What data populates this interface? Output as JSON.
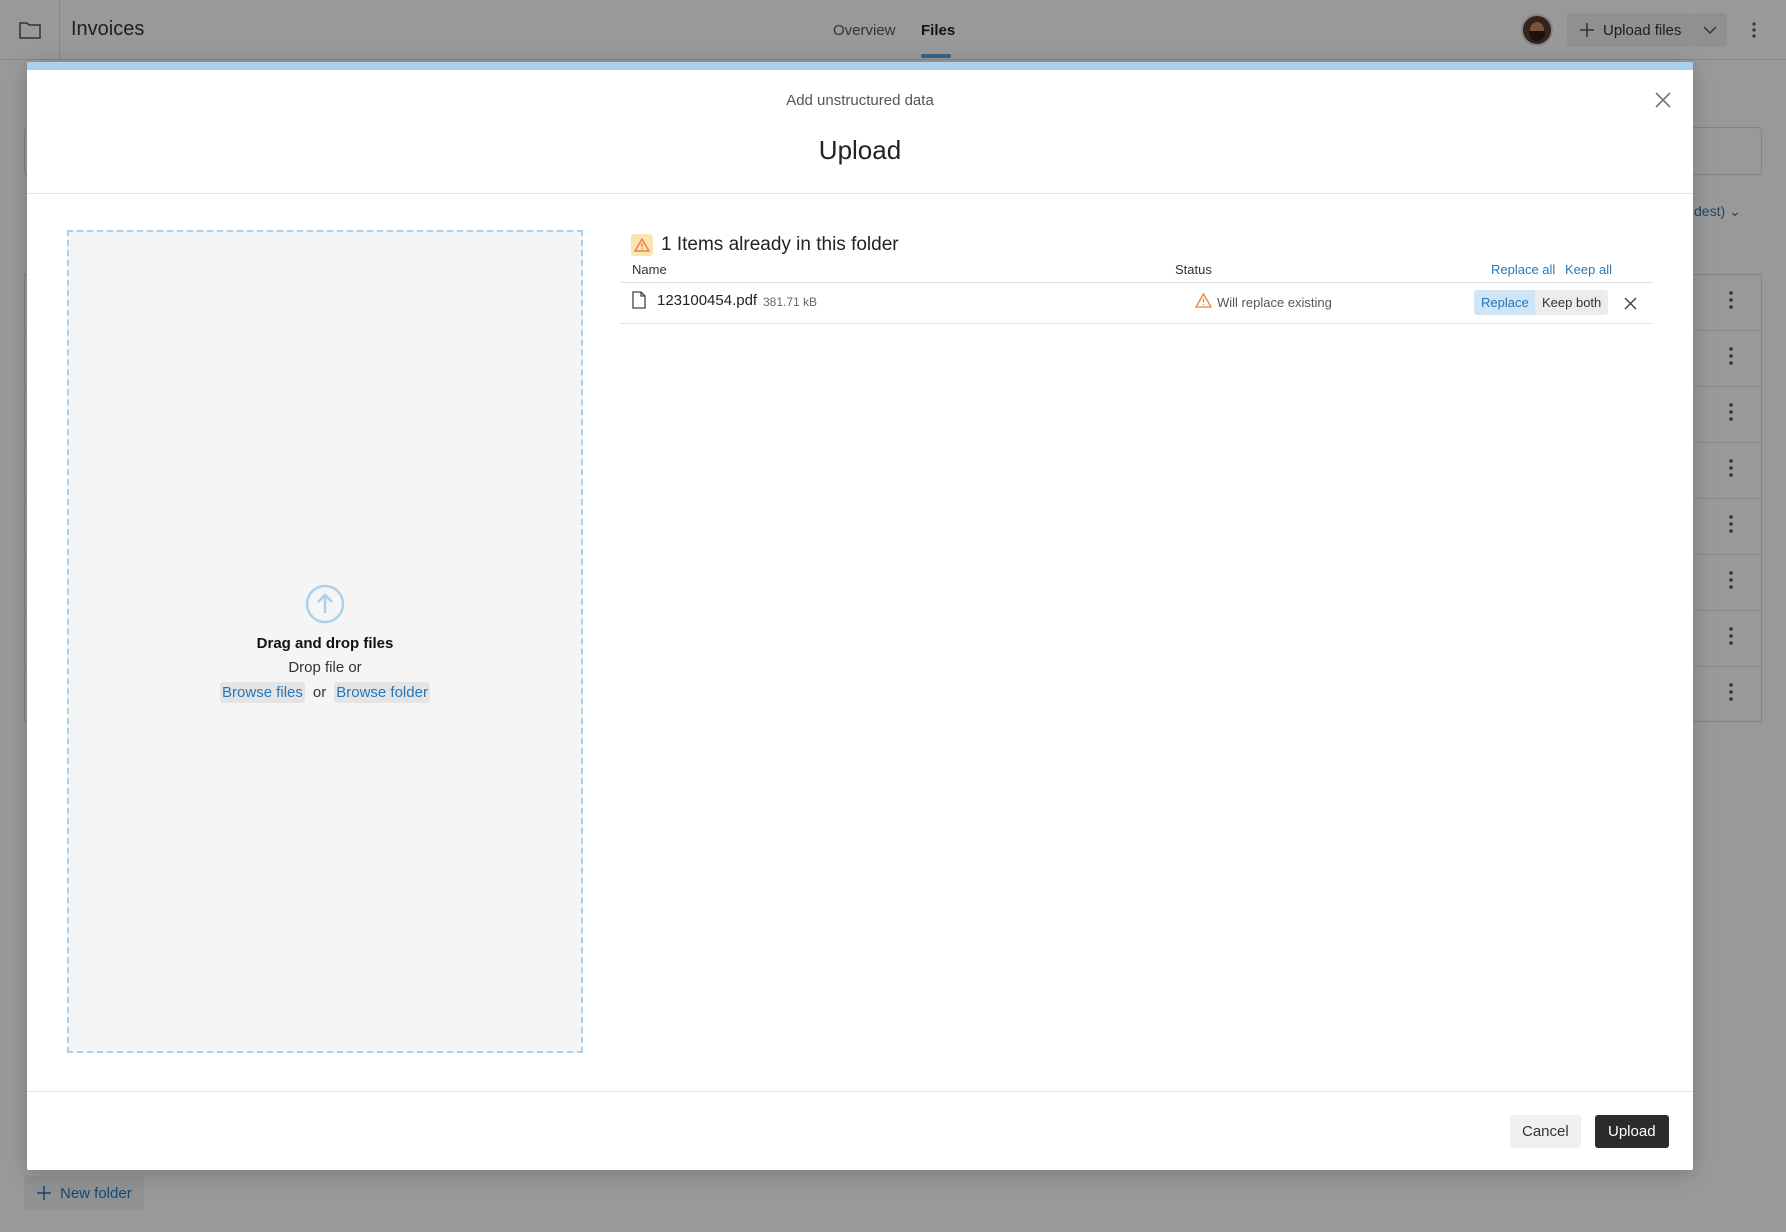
{
  "app": {
    "folder_title": "Invoices",
    "tabs": [
      {
        "label": "Overview",
        "active": false
      },
      {
        "label": "Files",
        "active": true
      }
    ],
    "upload_button_label": "Upload files",
    "sort_label": "Oldest)",
    "new_folder_label": "New folder"
  },
  "modal": {
    "subtitle": "Add unstructured data",
    "title": "Upload",
    "dropzone": {
      "title": "Drag and drop files",
      "subtitle": "Drop file or",
      "browse_files_label": "Browse files",
      "or_label": "or",
      "browse_folder_label": "Browse folder"
    },
    "conflicts": {
      "heading": "1 Items already in this folder",
      "columns": {
        "name": "Name",
        "status": "Status"
      },
      "replace_all_label": "Replace all",
      "keep_all_label": "Keep all",
      "rows": [
        {
          "file_name": "123100454.pdf",
          "file_size": "381.71 kB",
          "status": "Will replace existing",
          "replace_label": "Replace",
          "keep_both_label": "Keep both",
          "selected_action": "Replace"
        }
      ]
    },
    "footer": {
      "cancel_label": "Cancel",
      "upload_label": "Upload"
    }
  },
  "colors": {
    "accent": "#2a77b5",
    "accent_light": "#a9d0ec",
    "warning": "#e8833a",
    "primary_button": "#2b2b2b"
  }
}
